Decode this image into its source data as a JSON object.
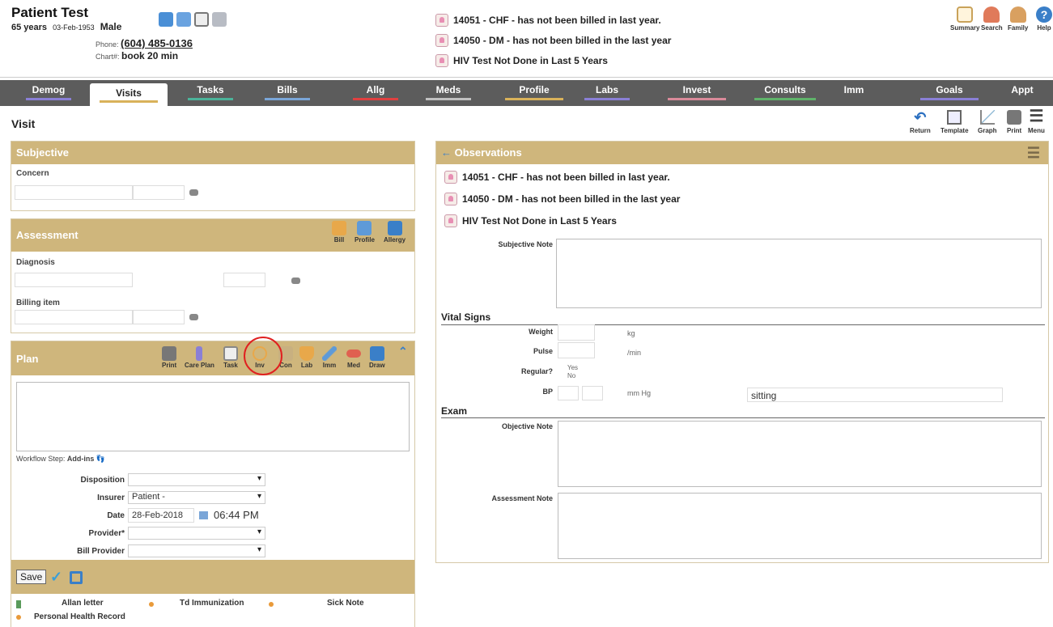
{
  "patient": {
    "name": "Patient Test",
    "age": "65 years",
    "dob": "03-Feb-1953",
    "sex": "Male",
    "phone_label": "Phone:",
    "phone": "(604) 485-0136",
    "chart_label": "Chart#:",
    "chart": "book 20 min"
  },
  "alerts": [
    "14051 - CHF - has not been billed in last year.",
    "14050 - DM - has not been billed in the last year",
    "HIV Test Not Done in Last 5 Years"
  ],
  "topnav": {
    "summary": "Summary",
    "search": "Search",
    "family": "Family",
    "help": "Help"
  },
  "tabs": [
    {
      "label": "Demog",
      "color": "#8a7fd6"
    },
    {
      "label": "Visits",
      "color": "#d9b25a"
    },
    {
      "label": "Tasks",
      "color": "#4bb39a"
    },
    {
      "label": "Bills",
      "color": "#7aa6d8"
    },
    {
      "label": "Allg",
      "color": "#e04040"
    },
    {
      "label": "Meds",
      "color": "#c0c0c0"
    },
    {
      "label": "Profile",
      "color": "#d9b25a"
    },
    {
      "label": "Labs",
      "color": "#8a7fd6"
    },
    {
      "label": "Invest",
      "color": "#d98a9a"
    },
    {
      "label": "Consults",
      "color": "#5fb36a"
    },
    {
      "label": "Imm",
      "color": "#5c5c5c"
    },
    {
      "label": "Goals",
      "color": "#8a7fd6"
    },
    {
      "label": "Appt",
      "color": "#5c5c5c"
    }
  ],
  "page_title": "Visit",
  "tools": {
    "return": "Return",
    "template": "Template",
    "graph": "Graph",
    "print": "Print",
    "menu": "Menu"
  },
  "subjective": {
    "title": "Subjective",
    "concern_label": "Concern"
  },
  "assessment": {
    "title": "Assessment",
    "bill": "Bill",
    "profile": "Profile",
    "allergy": "Allergy",
    "diagnosis_label": "Diagnosis",
    "billing_label": "Billing item"
  },
  "plan": {
    "title": "Plan",
    "buttons": [
      "Print",
      "Care Plan",
      "Task",
      "Inv",
      "Con",
      "Lab",
      "Imm",
      "Med",
      "Draw"
    ],
    "workflow_label": "Workflow Step:",
    "workflow_value": "Add-ins",
    "disposition_label": "Disposition",
    "disposition_value": "",
    "insurer_label": "Insurer",
    "insurer_value": "Patient -",
    "date_label": "Date",
    "date_value": "28-Feb-2018",
    "time_value": "06:44 PM",
    "provider_label": "Provider*",
    "provider_value": "",
    "bill_provider_label": "Bill Provider",
    "bill_provider_value": "",
    "save_label": "Save"
  },
  "quick_links": [
    "Allan letter",
    "Td Immunization",
    "Sick Note",
    "Personal Health Record"
  ],
  "observations": {
    "title": "Observations",
    "subjective_note_label": "Subjective Note",
    "vital_signs_title": "Vital Signs",
    "weight_label": "Weight",
    "weight_unit": "kg",
    "pulse_label": "Pulse",
    "pulse_unit": "/min",
    "regular_label": "Regular?",
    "yes": "Yes",
    "no": "No",
    "bp_label": "BP",
    "bp_unit": "mm Hg",
    "position_value": "sitting",
    "exam_title": "Exam",
    "objective_note_label": "Objective Note",
    "assessment_note_label": "Assessment Note"
  }
}
